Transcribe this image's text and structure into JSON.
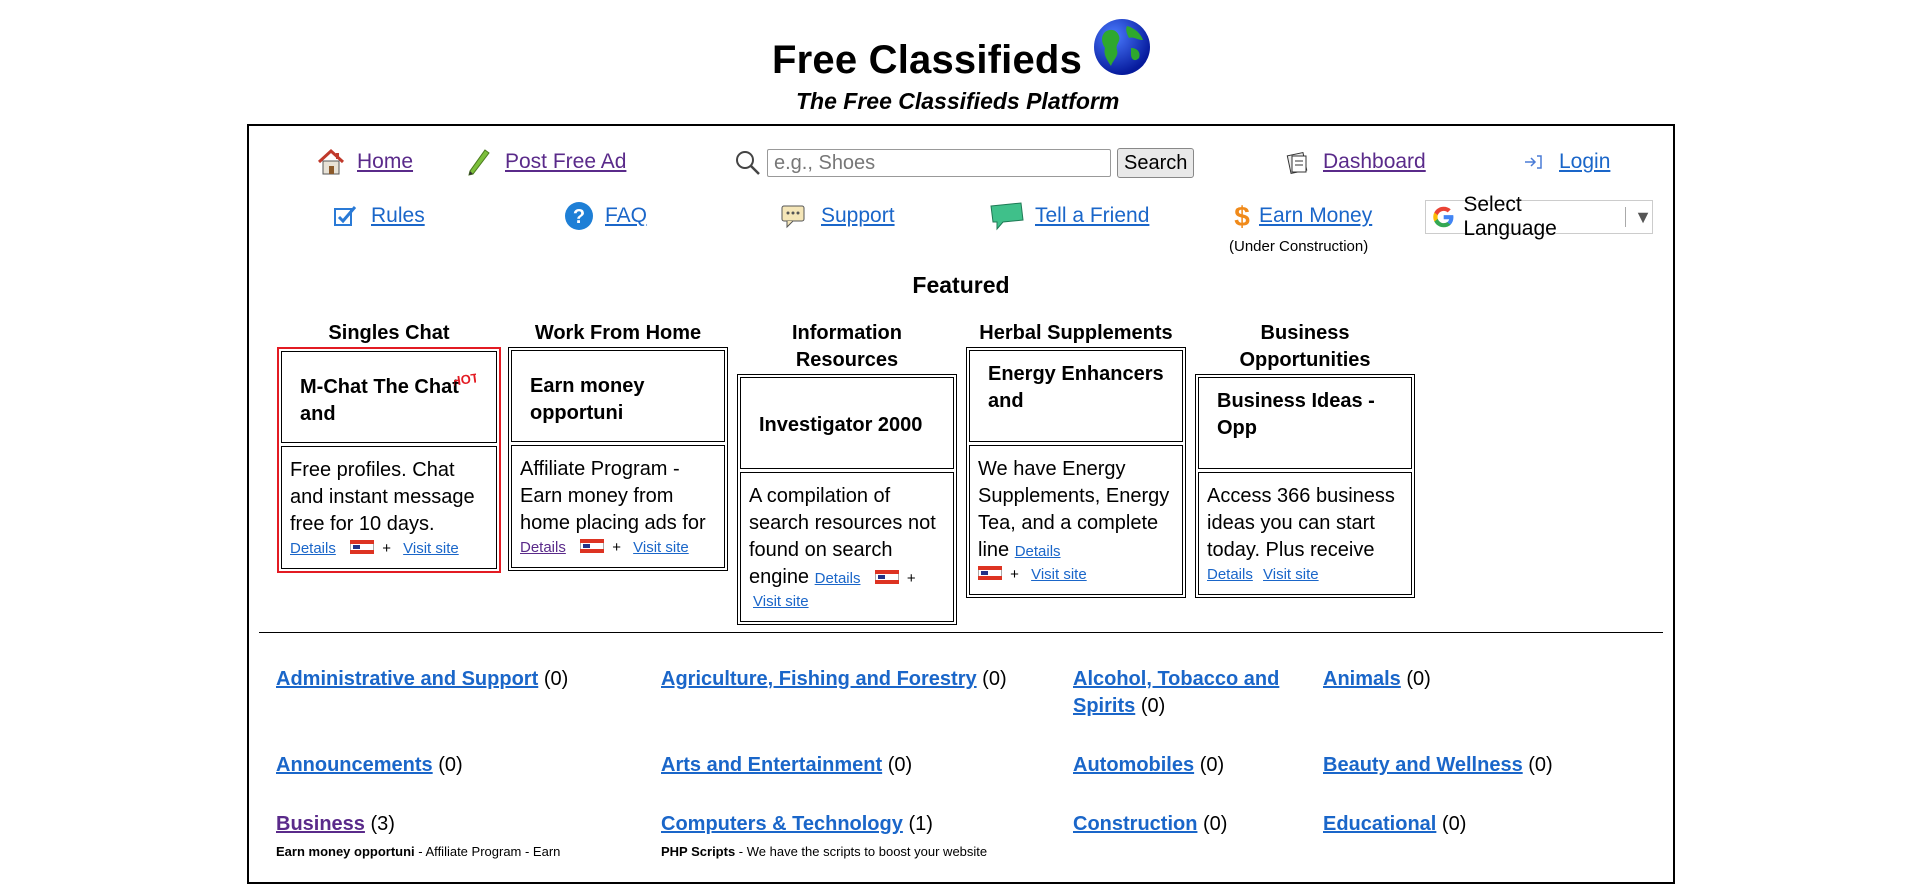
{
  "header": {
    "title": "Free Classifieds",
    "tagline": "The Free Classifieds Platform"
  },
  "nav": {
    "home": "Home",
    "post_free_ad": "Post Free Ad",
    "search_placeholder": "e.g., Shoes",
    "search_button": "Search",
    "dashboard": "Dashboard",
    "login": "Login",
    "rules": "Rules",
    "faq": "FAQ",
    "support": "Support",
    "tell_a_friend": "Tell a Friend",
    "earn_money": "Earn Money",
    "earn_money_note": "(Under Construction)",
    "select_language": "Select Language"
  },
  "featured": {
    "title": "Featured",
    "details_label": "Details",
    "visit_label": "Visit site",
    "plus": "+",
    "cards": [
      {
        "category": "Singles Chat",
        "headline": "M-Chat The Chat and",
        "description": "Free profiles. Chat and instant message free for 10 days."
      },
      {
        "category": "Work From Home",
        "headline": "Earn money opportuni",
        "description": "Affiliate Program - Earn money from home placing ads for"
      },
      {
        "category": "Information Resources",
        "headline": "Investigator 2000",
        "description": "A compilation of search resources not found on search engine"
      },
      {
        "category": "Herbal Supplements",
        "headline": "Energy Enhancers and",
        "description": "We have Energy Supplements, Energy Tea, and a complete line"
      },
      {
        "category": "Business Opportunities",
        "headline": "Business Ideas - Opp",
        "description": "Access 366 business ideas you can start today. Plus receive"
      }
    ]
  },
  "categories": [
    {
      "name": "Administrative and Support",
      "count": "(0)"
    },
    {
      "name": "Agriculture, Fishing and Forestry",
      "count": "(0)"
    },
    {
      "name": "Alcohol, Tobacco and Spirits",
      "count": "(0)"
    },
    {
      "name": "Animals",
      "count": "(0)"
    },
    {
      "name": "Announcements",
      "count": "(0)"
    },
    {
      "name": "Arts and Entertainment",
      "count": "(0)"
    },
    {
      "name": "Automobiles",
      "count": "(0)"
    },
    {
      "name": "Beauty and Wellness",
      "count": "(0)"
    },
    {
      "name": "Business",
      "count": "(3)"
    },
    {
      "name": "Computers & Technology",
      "count": "(1)"
    },
    {
      "name": "Construction",
      "count": "(0)"
    },
    {
      "name": "Educational",
      "count": "(0)"
    }
  ],
  "sub_listings": [
    {
      "title": "Earn money opportuni",
      "snippet": "Affiliate Program - Earn"
    },
    {
      "title": "PHP Scripts",
      "snippet": "We have the scripts to boost your website"
    }
  ],
  "colors": {
    "link": "#1a66c9",
    "visited": "#5a2a8a",
    "hot_border": "#e31b23"
  }
}
